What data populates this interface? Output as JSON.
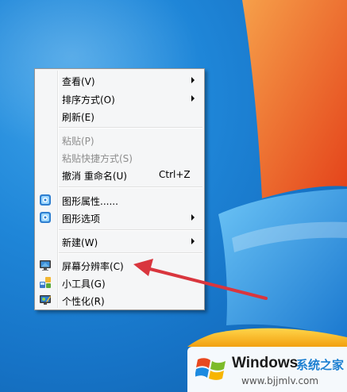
{
  "context_menu": {
    "items": [
      {
        "label": "查看(V)",
        "submenu": true
      },
      {
        "label": "排序方式(O)",
        "submenu": true
      },
      {
        "label": "刷新(E)"
      },
      {
        "label": "粘贴(P)",
        "disabled": true
      },
      {
        "label": "粘贴快捷方式(S)",
        "disabled": true
      },
      {
        "label": "撤消 重命名(U)",
        "shortcut": "Ctrl+Z"
      },
      {
        "label": "图形属性......",
        "icon": "graphics-properties-icon"
      },
      {
        "label": "图形选项",
        "icon": "graphics-options-icon",
        "submenu": true
      },
      {
        "label": "新建(W)",
        "submenu": true
      },
      {
        "label": "屏幕分辨率(C)",
        "icon": "screen-resolution-icon"
      },
      {
        "label": "小工具(G)",
        "icon": "gadgets-icon"
      },
      {
        "label": "个性化(R)",
        "icon": "personalize-icon"
      }
    ]
  },
  "watermark": {
    "brand": "Windows",
    "site": "系统之家",
    "url": "www.bjjmlv.com"
  },
  "colors": {
    "annotation_arrow": "#d9363e",
    "desktop_blue": "#1673c6",
    "menu_bg": "#f5f6f7"
  }
}
